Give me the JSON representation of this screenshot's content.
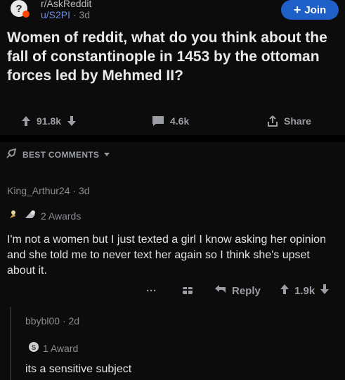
{
  "post": {
    "subreddit": "r/AskReddit",
    "author": "u/S2PI",
    "age": "3d",
    "join_label": "Join",
    "title": "Women of reddit, what do you think about the fall of constantinople in 1453 by the ottoman forces led by Mehmed II?",
    "upvotes": "91.8k",
    "comments": "4.6k",
    "share_label": "Share"
  },
  "sort": {
    "label": "BEST COMMENTS"
  },
  "comments": [
    {
      "author": "King_Arthur24",
      "age": "3d",
      "awards": "2 Awards",
      "body": "I'm not a women but I just texted a girl I know asking her opinion and she told me to never text her again so I think she's upset about it.",
      "more": "···",
      "reply_label": "Reply",
      "score": "1.9k"
    },
    {
      "author": "bbybl00",
      "age": "2d",
      "awards": "1 Award",
      "body": "its a sensitive subject"
    }
  ],
  "colors": {
    "background": "#0c0c0d",
    "join_button": "#1f5fc8",
    "username": "#6d8fe0"
  }
}
